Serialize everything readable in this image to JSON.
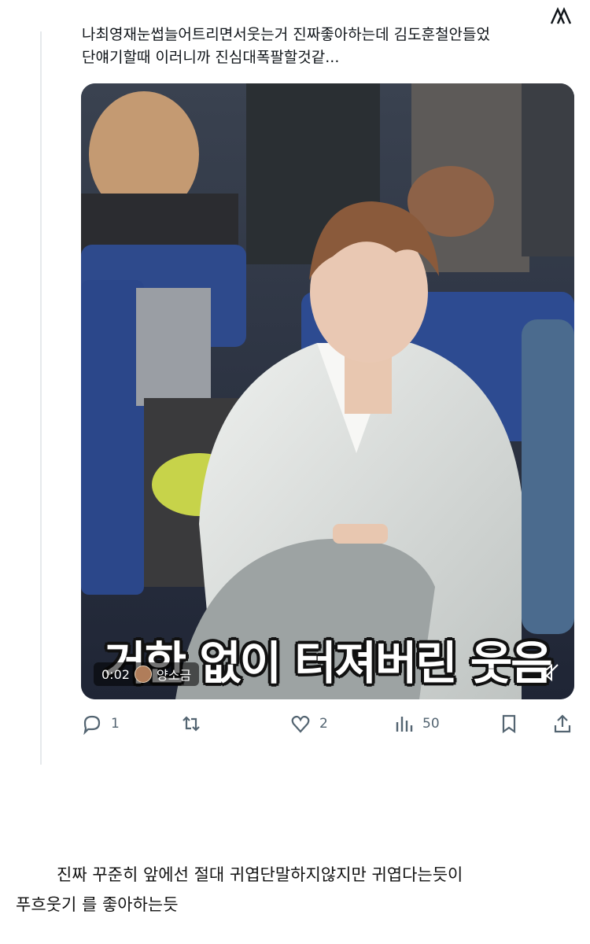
{
  "tweet": {
    "line1": "나최영재눈썹늘어트리면서웃는거 진짜좋아하는데 김도훈철안들었",
    "line2": "단얘기할때 이러니까 진심대폭팔할것같..."
  },
  "video": {
    "caption": "거한 없이 터져버린 웃음",
    "time": "0:02",
    "channel": "양소금"
  },
  "actions": {
    "reply_count": "1",
    "retweet_count": "",
    "like_count": "2",
    "view_count": "50"
  },
  "icons": {
    "corner": "logo-icon",
    "reply": "reply-icon",
    "retweet": "retweet-icon",
    "like": "heart-icon",
    "views": "views-icon",
    "bookmark": "bookmark-icon",
    "share": "share-icon",
    "mute": "mute-icon"
  },
  "comment": {
    "line1": "진짜 꾸준히 앞에선 절대 귀엽단말하지않지만 귀엽다는듯이",
    "line2": "푸흐웃기 를 좋아하는듯"
  }
}
